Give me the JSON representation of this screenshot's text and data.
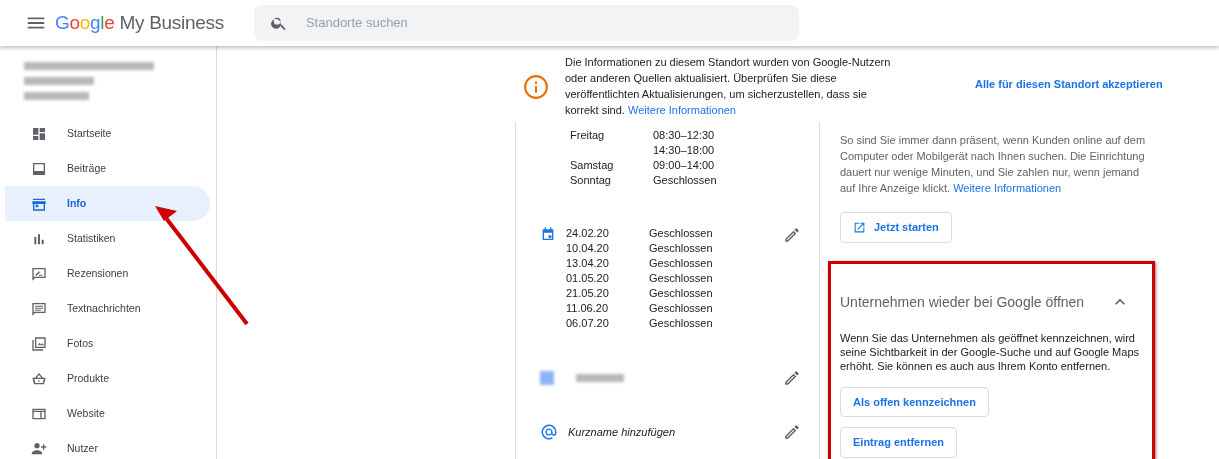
{
  "header": {
    "brand": "Google",
    "product": "My Business",
    "search": {
      "placeholder": "Standorte suchen"
    }
  },
  "sidebar": {
    "items": [
      {
        "label": "Startseite",
        "selected": false
      },
      {
        "label": "Beiträge",
        "selected": false
      },
      {
        "label": "Info",
        "selected": true
      },
      {
        "label": "Statistiken",
        "selected": false
      },
      {
        "label": "Rezensionen",
        "selected": false
      },
      {
        "label": "Textnachrichten",
        "selected": false
      },
      {
        "label": "Fotos",
        "selected": false
      },
      {
        "label": "Produkte",
        "selected": false
      },
      {
        "label": "Website",
        "selected": false
      },
      {
        "label": "Nutzer",
        "selected": false
      }
    ]
  },
  "notice": {
    "text": "Die Informationen zu diesem Standort wurden von Google-Nutzern oder anderen Quellen aktualisiert. Überprüfen Sie diese veröffentlichten Aktualisierungen, um sicherzustellen, dass sie korrekt sind.",
    "link": "Weitere Informationen",
    "action": "Alle für diesen Standort akzeptieren"
  },
  "hours": [
    {
      "day": "Freitag",
      "times": [
        "08:30–12:30",
        "14:30–18:00"
      ]
    },
    {
      "day": "Samstag",
      "times": [
        "09:00–14:00"
      ]
    },
    {
      "day": "Sonntag",
      "times": [
        "Geschlossen"
      ]
    }
  ],
  "special_hours": [
    {
      "date": "24.02.20",
      "value": "Geschlossen"
    },
    {
      "date": "10.04.20",
      "value": "Geschlossen"
    },
    {
      "date": "13.04.20",
      "value": "Geschlossen"
    },
    {
      "date": "01.05.20",
      "value": "Geschlossen"
    },
    {
      "date": "21.05.20",
      "value": "Geschlossen"
    },
    {
      "date": "11.06.20",
      "value": "Geschlossen"
    },
    {
      "date": "06.07.20",
      "value": "Geschlossen"
    }
  ],
  "short_name": {
    "label": "Kurzname hinzufügen"
  },
  "ads": {
    "text": "So sind Sie immer dann präsent, wenn Kunden online auf dem Computer oder Mobilgerät nach Ihnen suchen. Die Einrichtung dauert nur wenige Minuten, und Sie zahlen nur, wenn jemand auf Ihre Anzeige klickt.",
    "link": "Weitere Informationen",
    "button": "Jetzt starten"
  },
  "reopen": {
    "title": "Unternehmen wieder bei Google öffnen",
    "expanded": true,
    "text": "Wenn Sie das Unternehmen als geöffnet kennzeichnen, wird seine Sichtbarkeit in der Google-Suche und auf Google Maps erhöht. Sie können es auch aus Ihrem Konto entfernen.",
    "buttons": [
      "Als offen kennzeichnen",
      "Eintrag entfernen"
    ]
  }
}
